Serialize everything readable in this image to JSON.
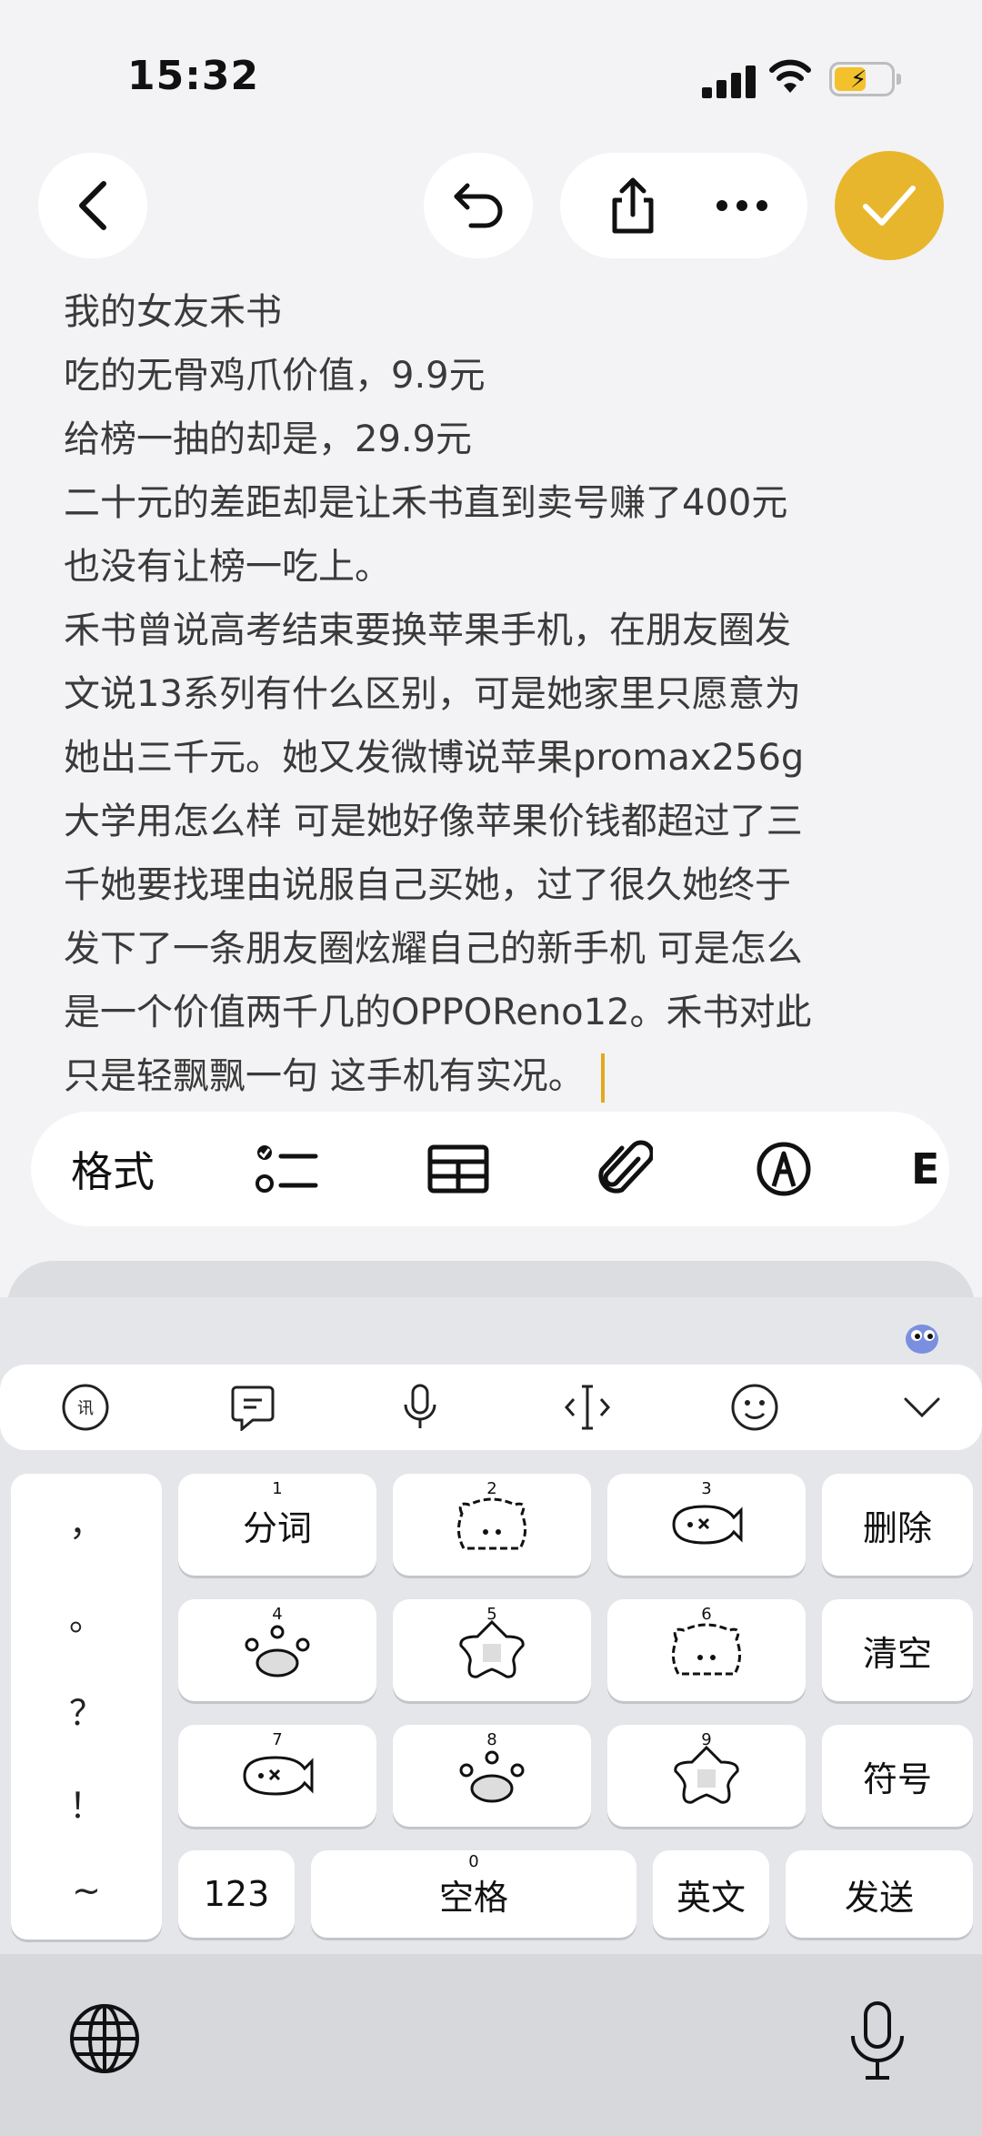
{
  "status_bar": {
    "time": "15:32"
  },
  "note": {
    "lines": [
      "我的女友禾书",
      "吃的无骨鸡爪价值，9.9元",
      "给榜一抽的却是，29.9元",
      "二十元的差距却是让禾书直到卖号赚了400元",
      "也没有让榜一吃上。",
      "禾书曾说高考结束要换苹果手机，在朋友圈发",
      "文说13系列有什么区别，可是她家里只愿意为",
      "她出三千元。她又发微博说苹果promax256g",
      "大学用怎么样 可是她好像苹果价钱都超过了三",
      "千她要找理由说服自己买她，过了很久她终于",
      "发下了一条朋友圈炫耀自己的新手机 可是怎么",
      "是一个价值两千几的OPPOReno12。禾书对此",
      "只是轻飘飘一句 这手机有实况。"
    ]
  },
  "toolbar": {
    "format_label": "格式",
    "cut_label": "E"
  },
  "keyboard": {
    "punct": [
      "，",
      "。",
      "？",
      "！",
      "~"
    ],
    "keys": {
      "fenci": "分词",
      "delete": "删除",
      "clear": "清空",
      "symbol": "符号",
      "num123": "123",
      "space": "空格",
      "english": "英文",
      "send": "发送"
    },
    "key_numbers": [
      "1",
      "2",
      "3",
      "4",
      "5",
      "6",
      "7",
      "8",
      "9",
      "0"
    ]
  },
  "colors": {
    "accent": "#e8b62d",
    "caret": "#e0a91f",
    "battery": "#f2c12c"
  }
}
